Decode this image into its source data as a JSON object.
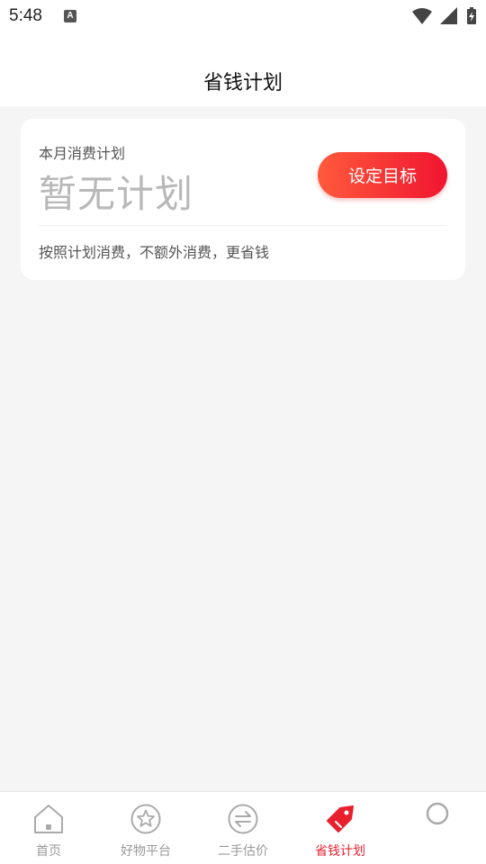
{
  "status_bar": {
    "time": "5:48",
    "notification_letter": "A"
  },
  "header": {
    "title": "省钱计划"
  },
  "plan_card": {
    "label": "本月消费计划",
    "status": "暂无计划",
    "button_label": "设定目标",
    "description": "按照计划消费，不额外消费，更省钱"
  },
  "bottom_nav": {
    "items": [
      {
        "label": "首页",
        "icon": "home-icon",
        "active": false
      },
      {
        "label": "好物平台",
        "icon": "star-icon",
        "active": false
      },
      {
        "label": "二手估价",
        "icon": "exchange-icon",
        "active": false
      },
      {
        "label": "省钱计划",
        "icon": "tag-icon",
        "active": true
      },
      {
        "label": "",
        "icon": "circle-icon",
        "active": false
      }
    ]
  },
  "colors": {
    "accent": "#e8202e",
    "button_gradient_start": "#ff5a3c",
    "button_gradient_end": "#f01530",
    "background": "#f5f5f5"
  }
}
